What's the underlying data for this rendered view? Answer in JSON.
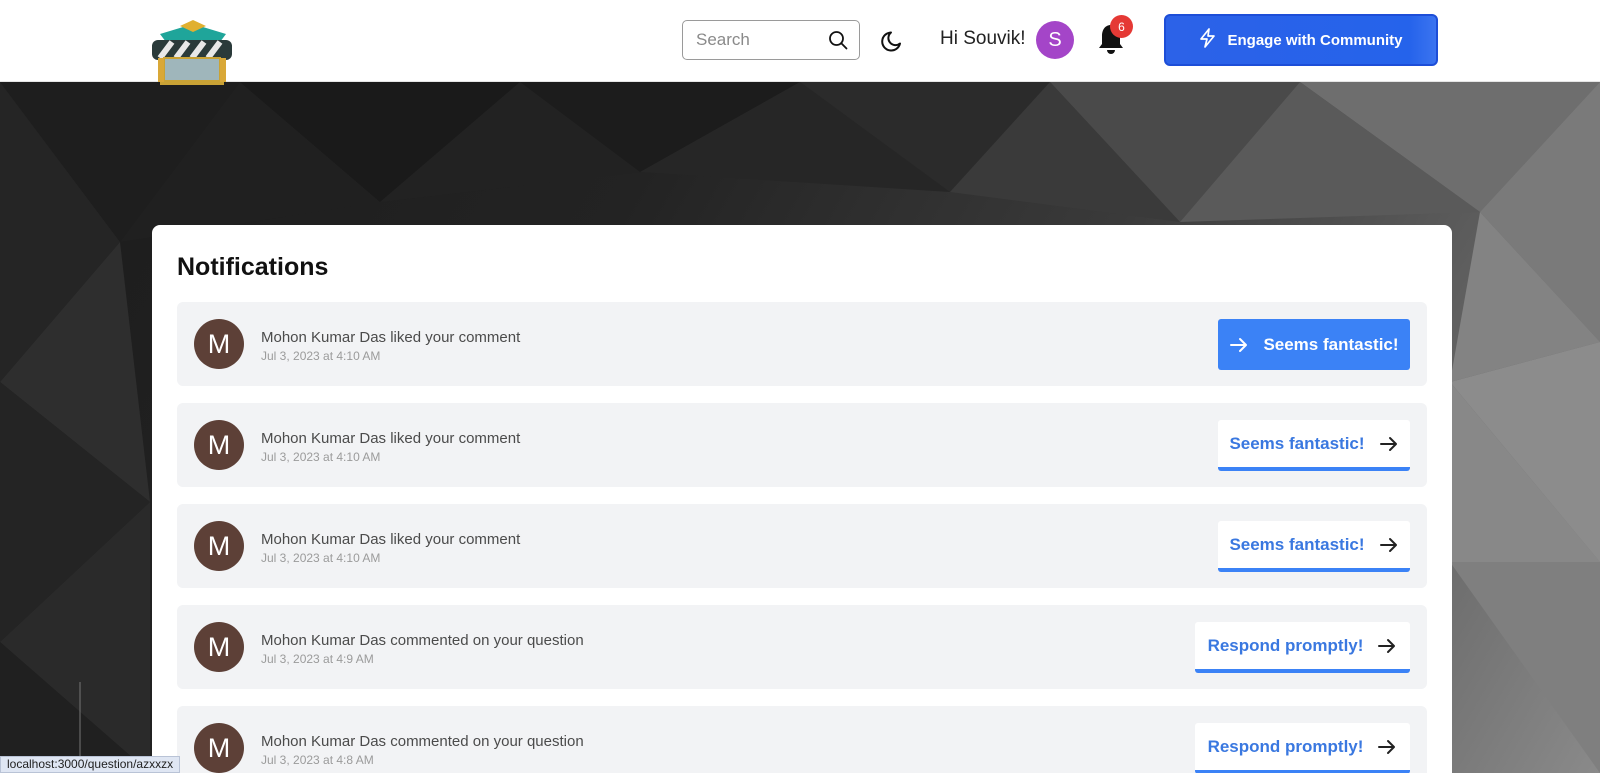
{
  "header": {
    "search": {
      "placeholder": "Search",
      "value": ""
    },
    "greeting": "Hi Souvik!",
    "avatar_letter": "S",
    "notification_count": "6",
    "engage_label": "Engage with Community"
  },
  "notifications": {
    "title": "Notifications",
    "items": [
      {
        "avatar": "M",
        "message": "Mohon Kumar Das liked your comment",
        "time": "Jul 3, 2023 at 4:10 AM",
        "action": "Seems fantastic!",
        "style": "solid"
      },
      {
        "avatar": "M",
        "message": "Mohon Kumar Das liked your comment",
        "time": "Jul 3, 2023 at 4:10 AM",
        "action": "Seems fantastic!",
        "style": "outline"
      },
      {
        "avatar": "M",
        "message": "Mohon Kumar Das liked your comment",
        "time": "Jul 3, 2023 at 4:10 AM",
        "action": "Seems fantastic!",
        "style": "outline"
      },
      {
        "avatar": "M",
        "message": "Mohon Kumar Das commented on your question",
        "time": "Jul 3, 2023 at 4:9 AM",
        "action": "Respond promptly!",
        "style": "outline"
      },
      {
        "avatar": "M",
        "message": "Mohon Kumar Das commented on your question",
        "time": "Jul 3, 2023 at 4:8 AM",
        "action": "Respond promptly!",
        "style": "outline"
      }
    ]
  },
  "status_bar": {
    "url": "localhost:3000/question/azxxzx"
  },
  "colors": {
    "primary": "#2563eb",
    "action_blue": "#3b82f6",
    "avatar_user": "#a445c8",
    "avatar_notifier": "#5d4037",
    "badge_red": "#e53935"
  },
  "icons": {
    "search": "search-icon",
    "theme": "moon-icon",
    "bell": "bell-icon",
    "engage": "lightning-icon",
    "arrow": "arrow-right-icon"
  }
}
